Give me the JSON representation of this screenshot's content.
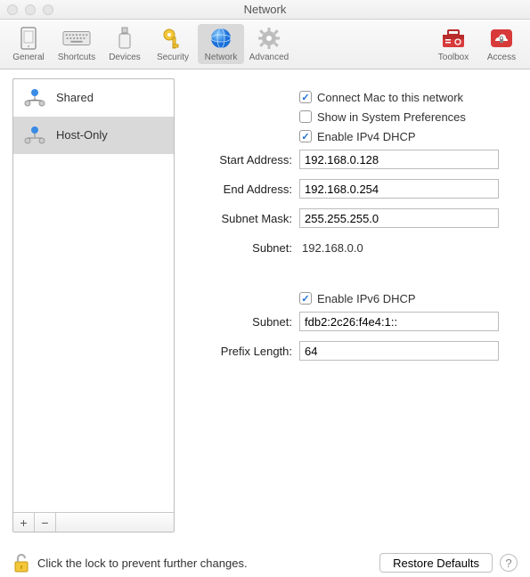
{
  "window": {
    "title": "Network"
  },
  "toolbar": {
    "items": [
      {
        "label": "General"
      },
      {
        "label": "Shortcuts"
      },
      {
        "label": "Devices"
      },
      {
        "label": "Security"
      },
      {
        "label": "Network"
      },
      {
        "label": "Advanced"
      }
    ],
    "right": [
      {
        "label": "Toolbox"
      },
      {
        "label": "Access"
      }
    ]
  },
  "sidebar": {
    "items": [
      {
        "label": "Shared"
      },
      {
        "label": "Host-Only"
      }
    ],
    "add": "+",
    "remove": "−"
  },
  "settings": {
    "connect_label": "Connect Mac to this network",
    "show_prefs_label": "Show in System Preferences",
    "enable_v4_label": "Enable IPv4 DHCP",
    "start_label": "Start Address:",
    "start_value": "192.168.0.128",
    "end_label": "End Address:",
    "end_value": "192.168.0.254",
    "mask_label": "Subnet Mask:",
    "mask_value": "255.255.255.0",
    "subnet_label": "Subnet:",
    "subnet_value": "192.168.0.0",
    "enable_v6_label": "Enable IPv6 DHCP",
    "v6_subnet_label": "Subnet:",
    "v6_subnet_value": "fdb2:2c26:f4e4:1::",
    "prefix_label": "Prefix Length:",
    "prefix_value": "64"
  },
  "footer": {
    "lock_text": "Click the lock to prevent further changes.",
    "restore_label": "Restore Defaults",
    "help": "?"
  }
}
